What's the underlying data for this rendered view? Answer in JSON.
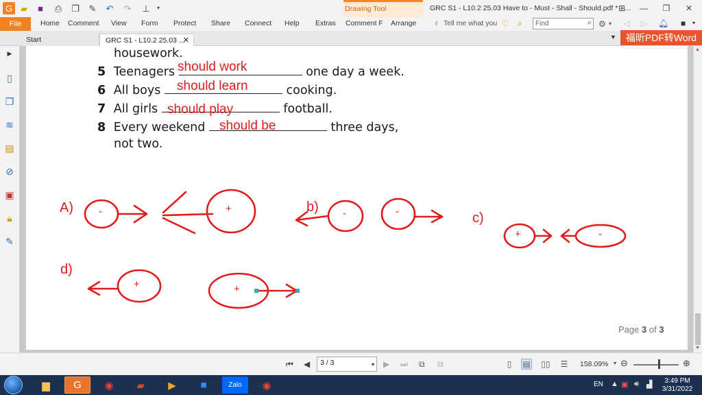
{
  "titlebar": {
    "drawing_tool": "Drawing Tool",
    "doc_title": "GRC S1 - L10.2 25.03 Have to - Must - Shall - Should.pdf * - ..."
  },
  "ribbon": {
    "tabs": [
      "File",
      "Home",
      "Comment",
      "View",
      "Form",
      "Protect",
      "Share",
      "Connect",
      "Help",
      "Extras",
      "Comment Fo",
      "Arrange"
    ],
    "tell_me": "Tell me what you",
    "find_placeholder": "Find"
  },
  "doc_tabs": {
    "start": "Start",
    "current": "GRC S1 - L10.2 25.03 ...",
    "banner": "福昕PDF转Word"
  },
  "document": {
    "line_housework": "housework.",
    "items": [
      {
        "num": "5",
        "before": "Teenagers",
        "after": "one day a week.",
        "answer": "should work"
      },
      {
        "num": "6",
        "before": "All boys",
        "after": "cooking.",
        "answer": "should learn"
      },
      {
        "num": "7",
        "before": "All girls",
        "after": "football.",
        "answer": "should play"
      },
      {
        "num": "8",
        "before": "Every weekend",
        "after": "three days,",
        "answer": "should be"
      }
    ],
    "line_not_two": "not two.",
    "hand_labels": {
      "a": "A)",
      "b": "b)",
      "c": "c)",
      "d": "d)"
    },
    "signs": {
      "minus": "-",
      "plus": "+"
    },
    "page_indicator": {
      "prefix": "Page",
      "current": "3",
      "of": "of",
      "total": "3"
    }
  },
  "statusbar": {
    "page_value": "3 / 3",
    "zoom": "158.09%"
  },
  "taskbar": {
    "lang": "EN",
    "time": "3:49 PM",
    "date": "3/31/2022",
    "apps": [
      "file-explorer",
      "foxit-pdf",
      "chrome",
      "powerpoint",
      "video",
      "zoom",
      "zalo",
      "chrome-profile"
    ]
  },
  "colors": {
    "ink": "#e11b1b",
    "accent": "#f48221",
    "banner": "#e8542e",
    "taskbar": "#1c3050"
  }
}
